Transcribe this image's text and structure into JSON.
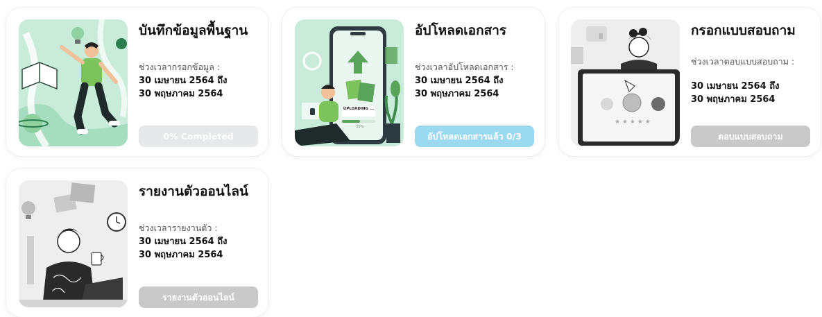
{
  "colors": {
    "accent_blue": "#9bd9f1",
    "mint_bg": "#c8ecd9",
    "disabled_btn": "#e6e8ea",
    "gray_btn": "#c9c9c9"
  },
  "cards": [
    {
      "title": "บันทึกข้อมูลพื้นฐาน",
      "period_label": "ช่วงเวลากรอกข้อมูล :",
      "date_from": "30 เมษายน 2564 ถึง",
      "date_to": "30 พฤษภาคม 2564",
      "button_label": "0% Completed",
      "status": "disabled"
    },
    {
      "title": "อัปโหลดเอกสาร",
      "period_label": "ช่วงเวลาอัปโหลดเอกสาร :",
      "date_from": "30 เมษายน 2564 ถึง",
      "date_to": "30 พฤษภาคม 2564",
      "button_label": "อัปโหลดเอกสารแล้ว 0/3",
      "status": "active",
      "illustration_text": {
        "uploading": "UPLOADING ...",
        "percent": "55%"
      }
    },
    {
      "title": "กรอกแบบสอบถาม",
      "period_label": "ช่วงเวลาตอบแบบสอบถาม :",
      "date_from": "30 เมษายน 2564 ถึง",
      "date_to": "30 พฤษภาคม 2564",
      "button_label": "ตอบแบบสอบถาม",
      "status": "inactive"
    },
    {
      "title": "รายงานตัวออนไลน์",
      "period_label": "ช่วงเวลารายงานตัว :",
      "date_from": "30 เมษายน 2564 ถึง",
      "date_to": "30 พฤษภาคม 2564",
      "button_label": "รายงานตัวออนไลน์",
      "status": "inactive"
    }
  ]
}
